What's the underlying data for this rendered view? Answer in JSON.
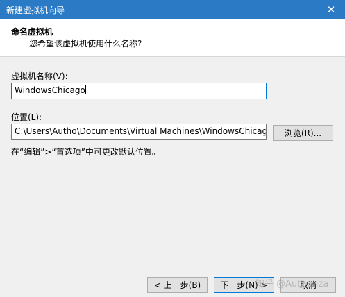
{
  "window": {
    "title": "新建虚拟机向导",
    "close_glyph": "✕"
  },
  "header": {
    "title": "命名虚拟机",
    "subtitle": "您希望该虚拟机使用什么名称?"
  },
  "form": {
    "name_label": "虚拟机名称(V):",
    "name_value": "WindowsChicago",
    "location_label": "位置(L):",
    "location_value": "C:\\Users\\Autho\\Documents\\Virtual Machines\\WindowsChicago",
    "browse_button": "浏览(R)...",
    "hint": "在“编辑”>“首选项”中可更改默认位置。"
  },
  "footer": {
    "back_button": "< 上一步(B)",
    "next_button": "下一步(N) >",
    "cancel_button": "取消"
  },
  "watermark": "知乎 @Authoriza",
  "colors": {
    "titlebar": "#2b7ac6",
    "accent_border": "#0078d7"
  }
}
